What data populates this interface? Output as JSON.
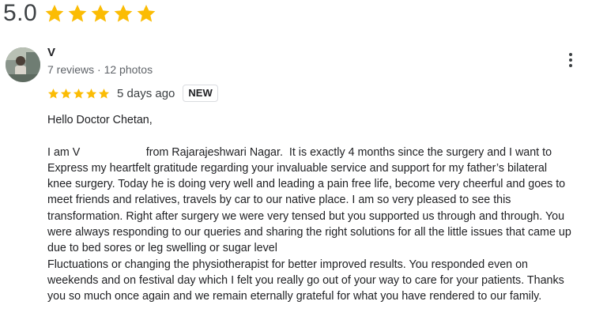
{
  "rating_summary": {
    "score": "5.0",
    "stars": 5
  },
  "review": {
    "author": "V",
    "author_meta": "7 reviews · 12 photos",
    "stars": 5,
    "date": "5 days ago",
    "badge": "NEW",
    "greeting": "Hello Doctor Chetan,",
    "line1": "I am V                     from Rajarajeshwari Nagar.  It is exactly 4 months since the surgery and I want to",
    "line2": "Express my heartfelt gratitude regarding your invaluable service and support for my father’s bilateral",
    "line3": "knee surgery. Today he is doing very well and leading a pain free life, become very cheerful and goes to",
    "line4": "meet friends and relatives, travels by car to our native place. I am so very pleased to see this",
    "line5": "transformation. Right after surgery we were very tensed but you supported us through and through. You",
    "line6": "were always responding to our queries and sharing the right solutions for all the little issues that came up",
    "line7": "due to bed sores or leg swelling or sugar level",
    "line8": "Fluctuations or changing the physiotherapist for better improved results. You responded even on",
    "line9": "weekends and on festival day which I felt you really go out of your way to care for your patients. Thanks",
    "line10": "you so much once again and we remain eternally grateful for what you have rendered to our family."
  },
  "colors": {
    "star": "#fbbc04",
    "text": "#202124",
    "secondary_text": "#5f6368"
  },
  "icons": {
    "star": "star-icon",
    "more": "more-vertical-icon"
  }
}
